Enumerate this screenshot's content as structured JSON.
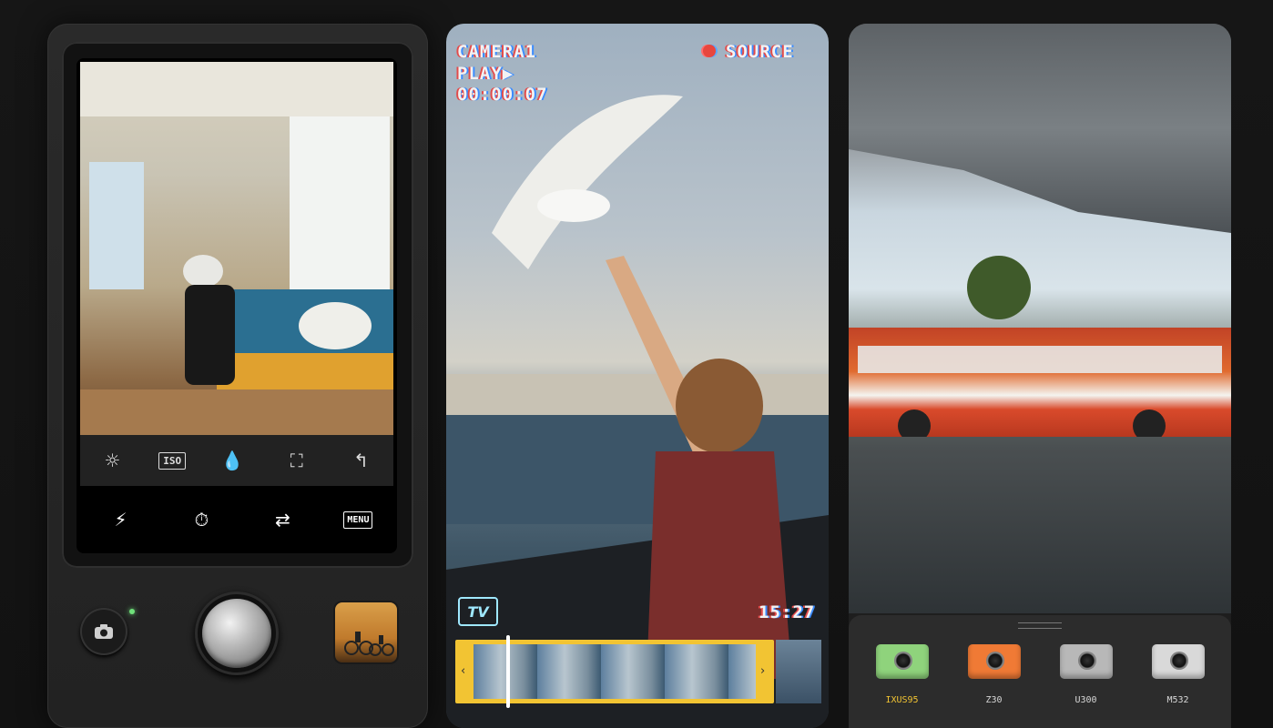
{
  "left": {
    "tools": {
      "brightness_icon": "☼",
      "iso_label": "ISO",
      "color_drop_icon": "💧",
      "frame_icon": "⛶",
      "rotate_icon": "↰"
    },
    "bottom": {
      "flash_icon": "⚡",
      "timer_icon": "⏱",
      "flip_icon": "⇄",
      "menu_label": "MENU"
    }
  },
  "vhs": {
    "camera_label": "CAMERA1",
    "play_label": "PLAY▶",
    "timecode": "00:00:07",
    "source_label": "SOURCE",
    "tv_label": "TV",
    "clock": "15:27"
  },
  "right": {
    "cameras": [
      {
        "label": "IXUS95",
        "color": "#8fd37c",
        "selected": true
      },
      {
        "label": "Z30",
        "color": "#f07a35",
        "selected": false
      },
      {
        "label": "U300",
        "color": "#b8b8b8",
        "selected": false
      },
      {
        "label": "M532",
        "color": "#d9d9d9",
        "selected": false
      }
    ]
  },
  "colors": {
    "accent": "#f2c433",
    "led": "#6fe07a",
    "rec": "#e8463e"
  }
}
